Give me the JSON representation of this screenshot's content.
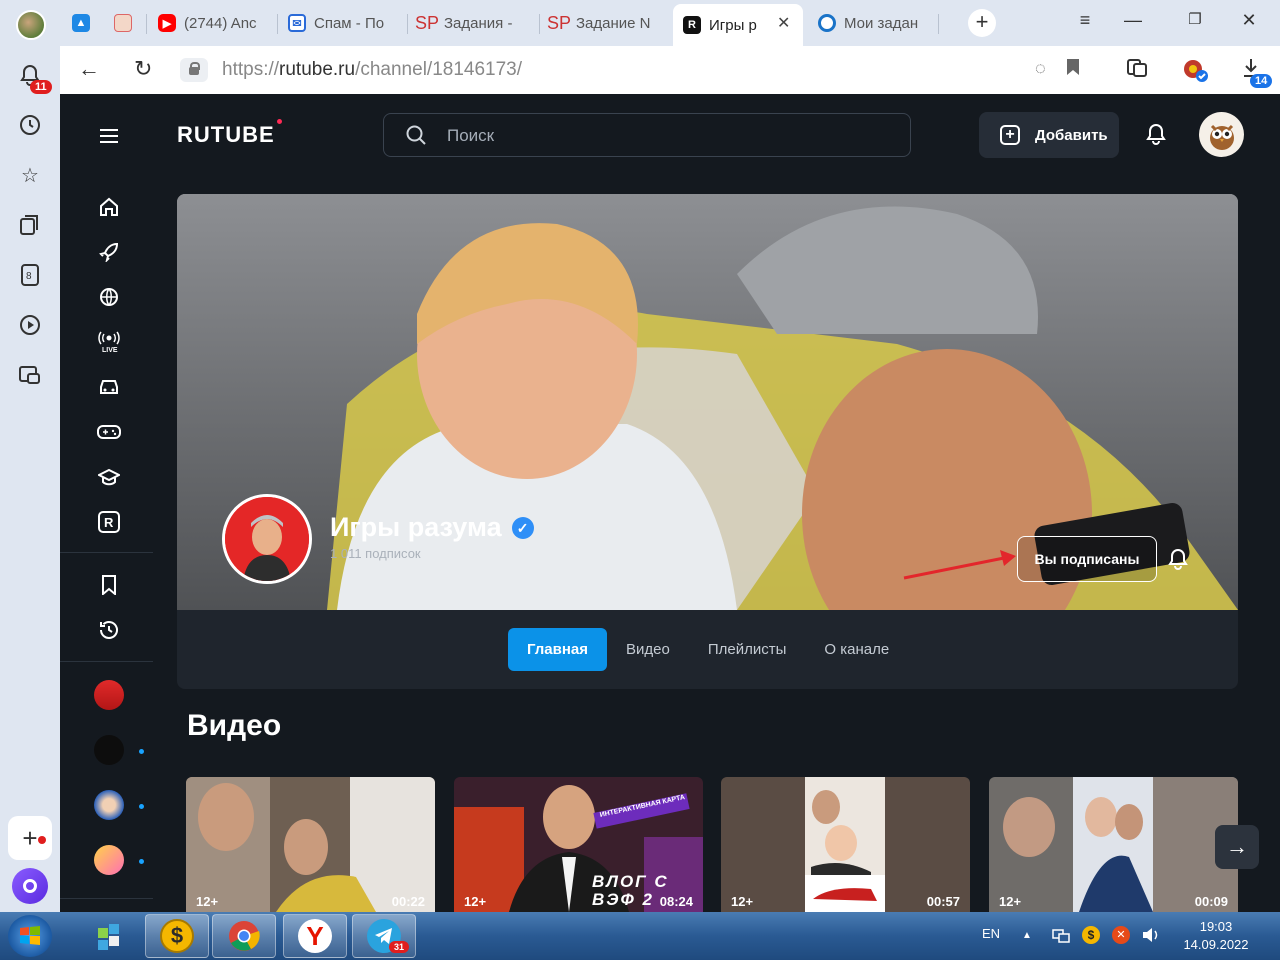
{
  "browser": {
    "tabs": [
      {
        "label": "(2744) Anc",
        "favicon": "youtube-icon"
      },
      {
        "label": "Спам - По",
        "favicon": "mail-icon"
      },
      {
        "label": "Задания -",
        "favicon": "sp-icon"
      },
      {
        "label": "Задание N",
        "favicon": "sp-icon"
      },
      {
        "label": "Игры р",
        "favicon": "rutube-icon",
        "active": true
      },
      {
        "label": "Мои задан",
        "favicon": "spiral-icon"
      }
    ],
    "url_prefix": "https://",
    "url_main": "rutube.ru",
    "url_path": "/channel/18146173/",
    "notifications_badge": "11",
    "downloads_badge": "14"
  },
  "header": {
    "logo": "RUTUBE",
    "search_placeholder": "Поиск",
    "add_button": "Добавить"
  },
  "channel": {
    "name": "Игры разума",
    "subscribers": "1 011 подписок",
    "subscribed_button": "Вы подписаны",
    "tabs": [
      "Главная",
      "Видео",
      "Плейлисты",
      "О канале"
    ],
    "active_tab": "Главная"
  },
  "videos": {
    "title": "Видео",
    "items": [
      {
        "age": "12+",
        "duration": "00:22"
      },
      {
        "age": "12+",
        "duration": "08:24",
        "overlay_text": "ВЛОГ С ВЭФ 2",
        "banner_text": "ИНТЕРАКТИВНАЯ КАРТА"
      },
      {
        "age": "12+",
        "duration": "00:57"
      },
      {
        "age": "12+",
        "duration": "00:09"
      }
    ]
  },
  "taskbar": {
    "lang": "EN",
    "time": "19:03",
    "date": "14.09.2022",
    "telegram_badge": "31"
  },
  "colors": {
    "page_bg": "#14191f",
    "accent": "#0b92e8",
    "panel": "#1f252d"
  }
}
